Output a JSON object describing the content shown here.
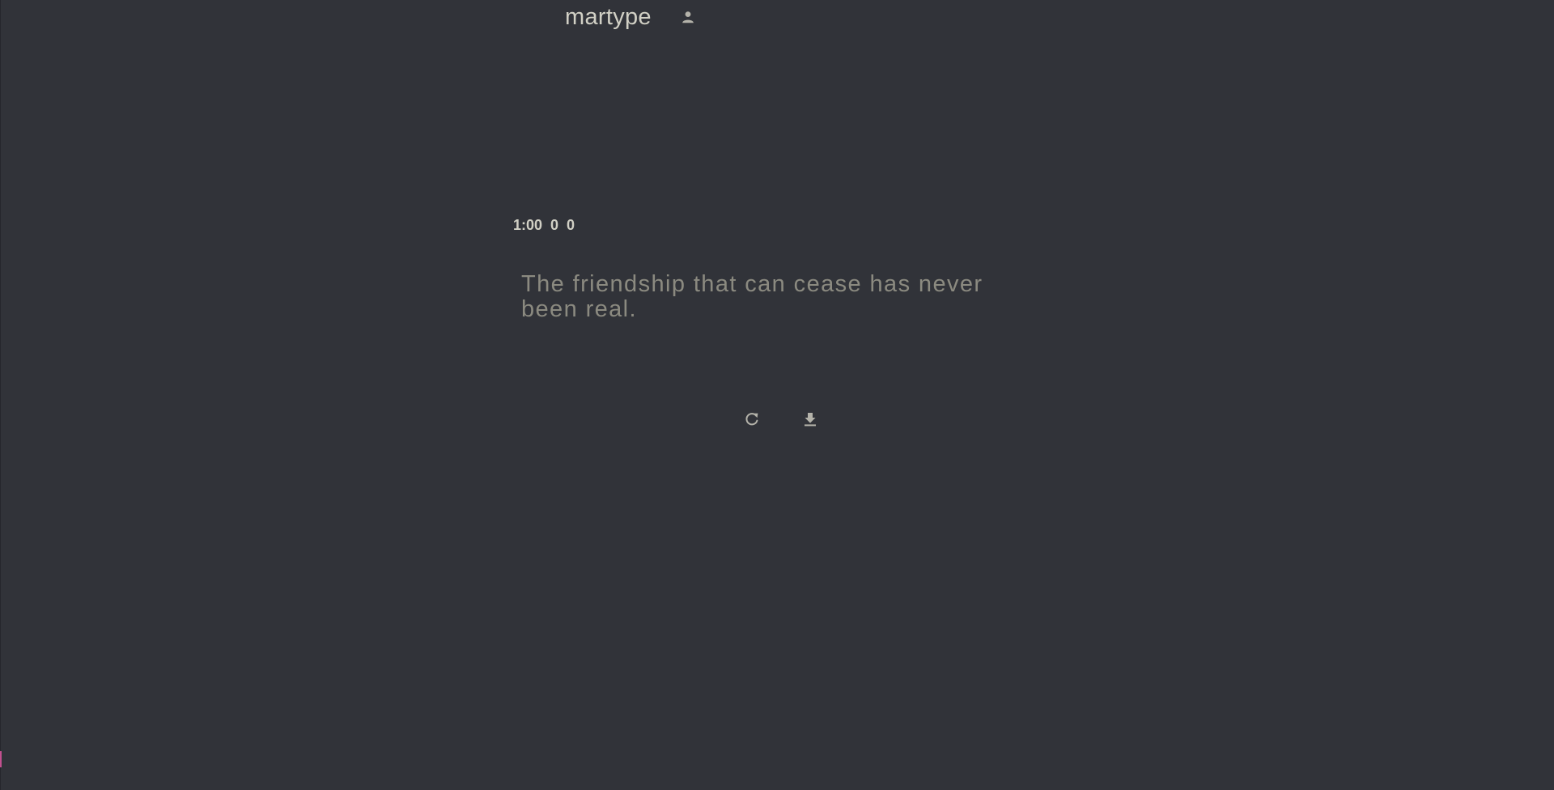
{
  "app": {
    "logo": "martype",
    "account_icon": "person-icon"
  },
  "stats": {
    "timer": "1:00",
    "wpm": "0",
    "accuracy": "0"
  },
  "test": {
    "text": "The friendship that can cease has never been real."
  },
  "controls": {
    "restart_icon": "refresh-icon",
    "download_icon": "download-icon"
  },
  "colors": {
    "background": "#313339",
    "main_text": "#d1d0c5",
    "sub_text": "#8b8a80",
    "caret": "#c2508f"
  }
}
